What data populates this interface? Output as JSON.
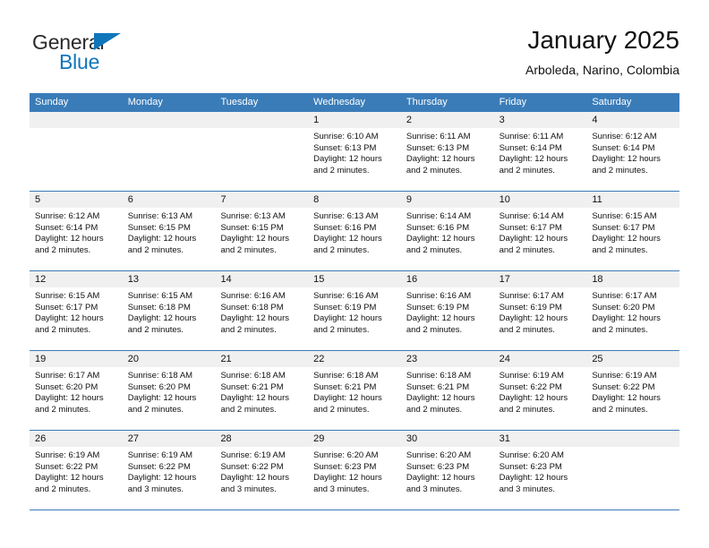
{
  "brand": {
    "word_one": "General",
    "word_two": "Blue",
    "triangle_color": "#1076BC",
    "text_color": "#2a2a2a"
  },
  "header": {
    "title": "January 2025",
    "subtitle": "Arboleda, Narino, Colombia"
  },
  "theme": {
    "header_blue": "#3A7CB8",
    "day_band_gray": "#F0F0F0",
    "text_black": "#111111",
    "brand_blue": "#1076BC"
  },
  "weekdays": [
    "Sunday",
    "Monday",
    "Tuesday",
    "Wednesday",
    "Thursday",
    "Friday",
    "Saturday"
  ],
  "weeks": [
    [
      {
        "day": "",
        "empty": true,
        "sunrise": "",
        "sunset": "",
        "daylight_line1": "",
        "daylight_line2": ""
      },
      {
        "day": "",
        "empty": true,
        "sunrise": "",
        "sunset": "",
        "daylight_line1": "",
        "daylight_line2": ""
      },
      {
        "day": "",
        "empty": true,
        "sunrise": "",
        "sunset": "",
        "daylight_line1": "",
        "daylight_line2": ""
      },
      {
        "day": "1",
        "empty": false,
        "sunrise": "Sunrise: 6:10 AM",
        "sunset": "Sunset: 6:13 PM",
        "daylight_line1": "Daylight: 12 hours",
        "daylight_line2": "and 2 minutes."
      },
      {
        "day": "2",
        "empty": false,
        "sunrise": "Sunrise: 6:11 AM",
        "sunset": "Sunset: 6:13 PM",
        "daylight_line1": "Daylight: 12 hours",
        "daylight_line2": "and 2 minutes."
      },
      {
        "day": "3",
        "empty": false,
        "sunrise": "Sunrise: 6:11 AM",
        "sunset": "Sunset: 6:14 PM",
        "daylight_line1": "Daylight: 12 hours",
        "daylight_line2": "and 2 minutes."
      },
      {
        "day": "4",
        "empty": false,
        "sunrise": "Sunrise: 6:12 AM",
        "sunset": "Sunset: 6:14 PM",
        "daylight_line1": "Daylight: 12 hours",
        "daylight_line2": "and 2 minutes."
      }
    ],
    [
      {
        "day": "5",
        "empty": false,
        "sunrise": "Sunrise: 6:12 AM",
        "sunset": "Sunset: 6:14 PM",
        "daylight_line1": "Daylight: 12 hours",
        "daylight_line2": "and 2 minutes."
      },
      {
        "day": "6",
        "empty": false,
        "sunrise": "Sunrise: 6:13 AM",
        "sunset": "Sunset: 6:15 PM",
        "daylight_line1": "Daylight: 12 hours",
        "daylight_line2": "and 2 minutes."
      },
      {
        "day": "7",
        "empty": false,
        "sunrise": "Sunrise: 6:13 AM",
        "sunset": "Sunset: 6:15 PM",
        "daylight_line1": "Daylight: 12 hours",
        "daylight_line2": "and 2 minutes."
      },
      {
        "day": "8",
        "empty": false,
        "sunrise": "Sunrise: 6:13 AM",
        "sunset": "Sunset: 6:16 PM",
        "daylight_line1": "Daylight: 12 hours",
        "daylight_line2": "and 2 minutes."
      },
      {
        "day": "9",
        "empty": false,
        "sunrise": "Sunrise: 6:14 AM",
        "sunset": "Sunset: 6:16 PM",
        "daylight_line1": "Daylight: 12 hours",
        "daylight_line2": "and 2 minutes."
      },
      {
        "day": "10",
        "empty": false,
        "sunrise": "Sunrise: 6:14 AM",
        "sunset": "Sunset: 6:17 PM",
        "daylight_line1": "Daylight: 12 hours",
        "daylight_line2": "and 2 minutes."
      },
      {
        "day": "11",
        "empty": false,
        "sunrise": "Sunrise: 6:15 AM",
        "sunset": "Sunset: 6:17 PM",
        "daylight_line1": "Daylight: 12 hours",
        "daylight_line2": "and 2 minutes."
      }
    ],
    [
      {
        "day": "12",
        "empty": false,
        "sunrise": "Sunrise: 6:15 AM",
        "sunset": "Sunset: 6:17 PM",
        "daylight_line1": "Daylight: 12 hours",
        "daylight_line2": "and 2 minutes."
      },
      {
        "day": "13",
        "empty": false,
        "sunrise": "Sunrise: 6:15 AM",
        "sunset": "Sunset: 6:18 PM",
        "daylight_line1": "Daylight: 12 hours",
        "daylight_line2": "and 2 minutes."
      },
      {
        "day": "14",
        "empty": false,
        "sunrise": "Sunrise: 6:16 AM",
        "sunset": "Sunset: 6:18 PM",
        "daylight_line1": "Daylight: 12 hours",
        "daylight_line2": "and 2 minutes."
      },
      {
        "day": "15",
        "empty": false,
        "sunrise": "Sunrise: 6:16 AM",
        "sunset": "Sunset: 6:19 PM",
        "daylight_line1": "Daylight: 12 hours",
        "daylight_line2": "and 2 minutes."
      },
      {
        "day": "16",
        "empty": false,
        "sunrise": "Sunrise: 6:16 AM",
        "sunset": "Sunset: 6:19 PM",
        "daylight_line1": "Daylight: 12 hours",
        "daylight_line2": "and 2 minutes."
      },
      {
        "day": "17",
        "empty": false,
        "sunrise": "Sunrise: 6:17 AM",
        "sunset": "Sunset: 6:19 PM",
        "daylight_line1": "Daylight: 12 hours",
        "daylight_line2": "and 2 minutes."
      },
      {
        "day": "18",
        "empty": false,
        "sunrise": "Sunrise: 6:17 AM",
        "sunset": "Sunset: 6:20 PM",
        "daylight_line1": "Daylight: 12 hours",
        "daylight_line2": "and 2 minutes."
      }
    ],
    [
      {
        "day": "19",
        "empty": false,
        "sunrise": "Sunrise: 6:17 AM",
        "sunset": "Sunset: 6:20 PM",
        "daylight_line1": "Daylight: 12 hours",
        "daylight_line2": "and 2 minutes."
      },
      {
        "day": "20",
        "empty": false,
        "sunrise": "Sunrise: 6:18 AM",
        "sunset": "Sunset: 6:20 PM",
        "daylight_line1": "Daylight: 12 hours",
        "daylight_line2": "and 2 minutes."
      },
      {
        "day": "21",
        "empty": false,
        "sunrise": "Sunrise: 6:18 AM",
        "sunset": "Sunset: 6:21 PM",
        "daylight_line1": "Daylight: 12 hours",
        "daylight_line2": "and 2 minutes."
      },
      {
        "day": "22",
        "empty": false,
        "sunrise": "Sunrise: 6:18 AM",
        "sunset": "Sunset: 6:21 PM",
        "daylight_line1": "Daylight: 12 hours",
        "daylight_line2": "and 2 minutes."
      },
      {
        "day": "23",
        "empty": false,
        "sunrise": "Sunrise: 6:18 AM",
        "sunset": "Sunset: 6:21 PM",
        "daylight_line1": "Daylight: 12 hours",
        "daylight_line2": "and 2 minutes."
      },
      {
        "day": "24",
        "empty": false,
        "sunrise": "Sunrise: 6:19 AM",
        "sunset": "Sunset: 6:22 PM",
        "daylight_line1": "Daylight: 12 hours",
        "daylight_line2": "and 2 minutes."
      },
      {
        "day": "25",
        "empty": false,
        "sunrise": "Sunrise: 6:19 AM",
        "sunset": "Sunset: 6:22 PM",
        "daylight_line1": "Daylight: 12 hours",
        "daylight_line2": "and 2 minutes."
      }
    ],
    [
      {
        "day": "26",
        "empty": false,
        "sunrise": "Sunrise: 6:19 AM",
        "sunset": "Sunset: 6:22 PM",
        "daylight_line1": "Daylight: 12 hours",
        "daylight_line2": "and 2 minutes."
      },
      {
        "day": "27",
        "empty": false,
        "sunrise": "Sunrise: 6:19 AM",
        "sunset": "Sunset: 6:22 PM",
        "daylight_line1": "Daylight: 12 hours",
        "daylight_line2": "and 3 minutes."
      },
      {
        "day": "28",
        "empty": false,
        "sunrise": "Sunrise: 6:19 AM",
        "sunset": "Sunset: 6:22 PM",
        "daylight_line1": "Daylight: 12 hours",
        "daylight_line2": "and 3 minutes."
      },
      {
        "day": "29",
        "empty": false,
        "sunrise": "Sunrise: 6:20 AM",
        "sunset": "Sunset: 6:23 PM",
        "daylight_line1": "Daylight: 12 hours",
        "daylight_line2": "and 3 minutes."
      },
      {
        "day": "30",
        "empty": false,
        "sunrise": "Sunrise: 6:20 AM",
        "sunset": "Sunset: 6:23 PM",
        "daylight_line1": "Daylight: 12 hours",
        "daylight_line2": "and 3 minutes."
      },
      {
        "day": "31",
        "empty": false,
        "sunrise": "Sunrise: 6:20 AM",
        "sunset": "Sunset: 6:23 PM",
        "daylight_line1": "Daylight: 12 hours",
        "daylight_line2": "and 3 minutes."
      },
      {
        "day": "",
        "empty": true,
        "sunrise": "",
        "sunset": "",
        "daylight_line1": "",
        "daylight_line2": ""
      }
    ]
  ]
}
